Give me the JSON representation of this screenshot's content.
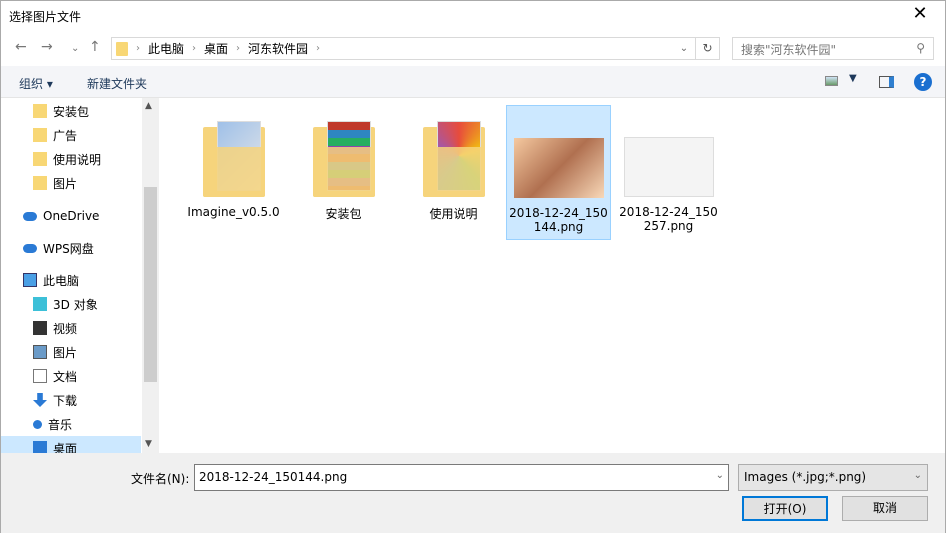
{
  "window": {
    "title": "选择图片文件",
    "close": "✕"
  },
  "address": {
    "crumbs": [
      "此电脑",
      "桌面",
      "河东软件园"
    ],
    "search_placeholder": "搜索\"河东软件园\""
  },
  "toolbar": {
    "organize": "组织 ▾",
    "new_folder": "新建文件夹"
  },
  "sidebar": {
    "items": [
      {
        "label": "安装包",
        "icon": "folder-icon"
      },
      {
        "label": "广告",
        "icon": "folder-icon"
      },
      {
        "label": "使用说明",
        "icon": "folder-icon"
      },
      {
        "label": "图片",
        "icon": "folder-icon"
      },
      {
        "label": "OneDrive",
        "icon": "cloud-icon"
      },
      {
        "label": "WPS网盘",
        "icon": "cloud-icon"
      },
      {
        "label": "此电脑",
        "icon": "computer-icon"
      },
      {
        "label": "3D 对象",
        "icon": "cube-icon"
      },
      {
        "label": "视频",
        "icon": "video-icon"
      },
      {
        "label": "图片",
        "icon": "picture-icon"
      },
      {
        "label": "文档",
        "icon": "document-icon"
      },
      {
        "label": "下载",
        "icon": "download-icon"
      },
      {
        "label": "音乐",
        "icon": "music-icon"
      },
      {
        "label": "桌面",
        "icon": "desktop-icon"
      }
    ]
  },
  "files": [
    {
      "name": "Imagine_v0.5.0",
      "type": "folder"
    },
    {
      "name": "安装包",
      "type": "folder"
    },
    {
      "name": "使用说明",
      "type": "folder"
    },
    {
      "name": "2018-12-24_150144.png",
      "type": "image",
      "selected": true
    },
    {
      "name": "2018-12-24_150257.png",
      "type": "image"
    }
  ],
  "footer": {
    "filename_label": "文件名(N):",
    "filename_value": "2018-12-24_150144.png",
    "filter": "Images (*.jpg;*.png)",
    "open": "打开(O)",
    "cancel": "取消"
  }
}
